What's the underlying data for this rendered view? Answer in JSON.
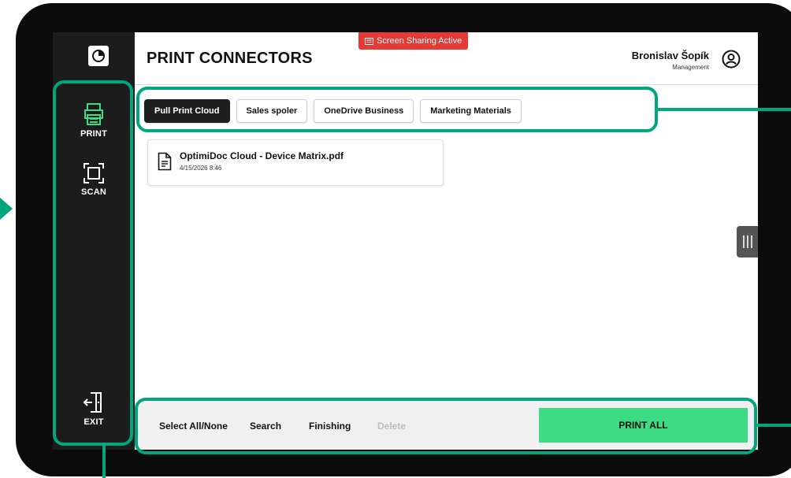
{
  "header": {
    "title": "PRINT CONNECTORS",
    "share_banner": "Screen Sharing Active",
    "user_name": "Bronislav Šopík",
    "user_role": "Management"
  },
  "sidebar": {
    "items": [
      {
        "label": "PRINT",
        "icon": "printer-icon",
        "active": true
      },
      {
        "label": "SCAN",
        "icon": "scan-icon",
        "active": false
      }
    ],
    "exit_label": "EXIT"
  },
  "tabs": [
    {
      "label": "Pull Print Cloud",
      "active": true
    },
    {
      "label": "Sales spoler",
      "active": false
    },
    {
      "label": "OneDrive Business",
      "active": false
    },
    {
      "label": "Marketing Materials",
      "active": false
    }
  ],
  "files": [
    {
      "name": "OptimiDoc Cloud - Device Matrix.pdf",
      "date": "4/15/2026 8:46",
      "icon": "document-icon"
    }
  ],
  "bottom_bar": {
    "select_all": "Select All/None",
    "search": "Search",
    "finishing": "Finishing",
    "delete": "Delete",
    "print_all": "PRINT ALL"
  },
  "colors": {
    "accent_green": "#3ddc84",
    "callout_green": "#00a67e",
    "banner_red": "#e53935",
    "sidebar_bg": "#1c1c1c"
  }
}
